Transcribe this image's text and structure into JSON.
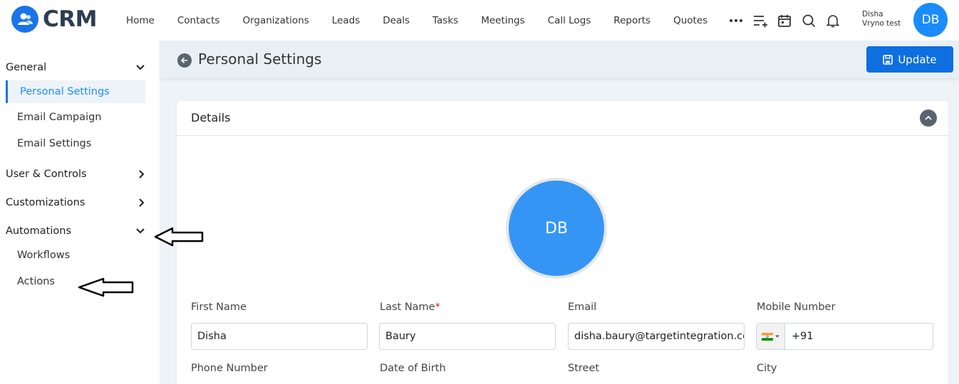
{
  "app": {
    "logo_text": "CRM"
  },
  "nav": {
    "items": [
      "Home",
      "Contacts",
      "Organizations",
      "Leads",
      "Deals",
      "Tasks",
      "Meetings",
      "Call Logs",
      "Reports",
      "Quotes"
    ]
  },
  "user": {
    "first_name": "Disha",
    "org": "Vryno test",
    "initials": "DB"
  },
  "sidebar": {
    "general": "General",
    "personal_settings": "Personal Settings",
    "email_campaign": "Email Campaign",
    "email_settings": "Email Settings",
    "user_controls": "User & Controls",
    "customizations": "Customizations",
    "automations": "Automations",
    "workflows": "Workflows",
    "actions": "Actions"
  },
  "page": {
    "title": "Personal Settings",
    "update_label": "Update"
  },
  "details": {
    "title": "Details",
    "avatar_initials": "DB",
    "first_name_label": "First Name",
    "first_name_value": "Disha",
    "last_name_label": "Last Name",
    "last_name_required": "*",
    "last_name_value": "Baury",
    "email_label": "Email",
    "email_value": "disha.baury@targetintegration.com",
    "mobile_label": "Mobile Number",
    "mobile_code": "+91",
    "phone_label": "Phone Number",
    "dob_label": "Date of Birth",
    "street_label": "Street",
    "city_label": "City"
  },
  "colors": {
    "accent": "#1a73e8",
    "avatar": "#3595f5",
    "button": "#0d6fe0"
  }
}
